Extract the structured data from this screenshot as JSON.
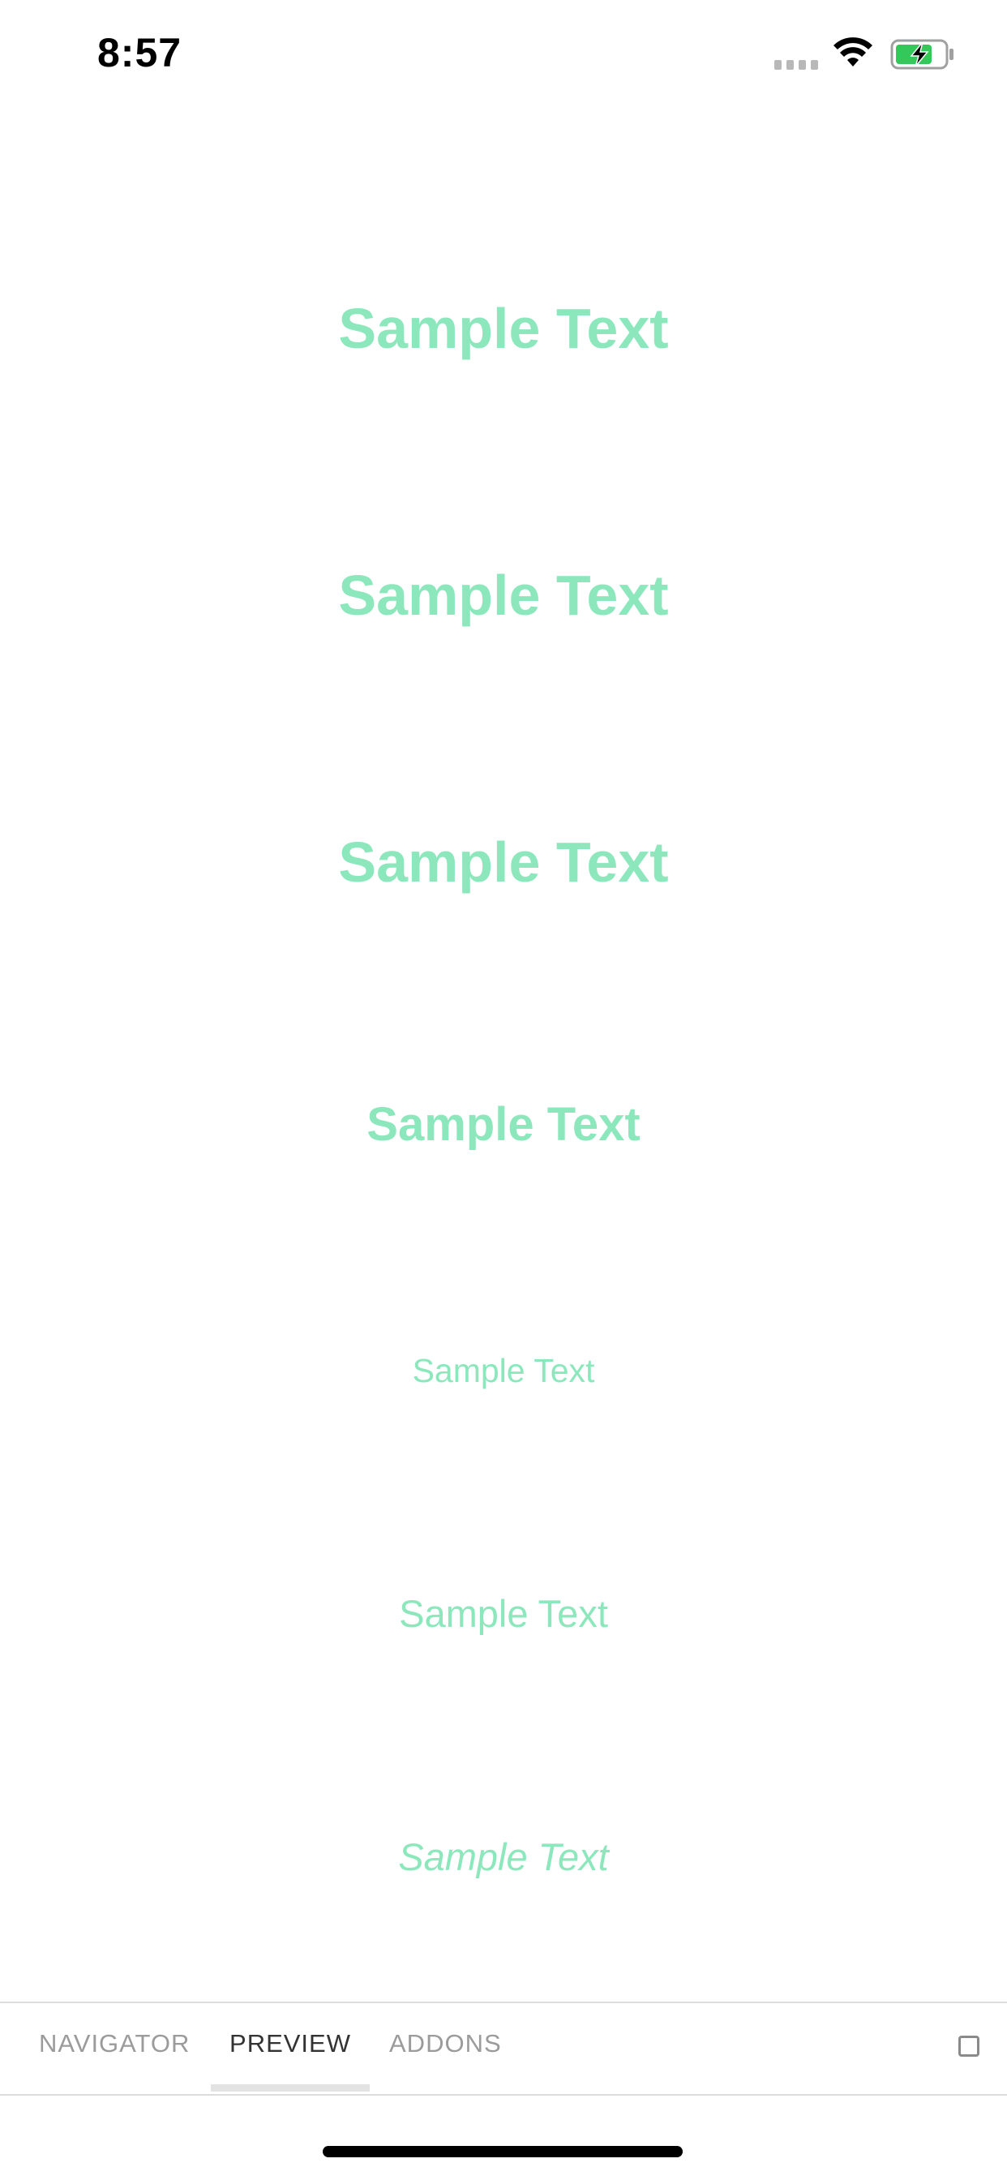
{
  "status_bar": {
    "time": "8:57",
    "signal_icon": "cellular-dots-icon",
    "wifi_icon": "wifi-icon",
    "battery_icon": "battery-charging-icon",
    "battery_color": "#34c759"
  },
  "content": {
    "text_color": "#8ce8bc",
    "samples": [
      {
        "text": "Sample Text",
        "style": "bold"
      },
      {
        "text": "Sample Text",
        "style": "bold"
      },
      {
        "text": "Sample Text",
        "style": "bold"
      },
      {
        "text": "Sample Text",
        "style": "bold"
      },
      {
        "text": "Sample Text",
        "style": "regular"
      },
      {
        "text": "Sample Text",
        "style": "regular"
      },
      {
        "text": "Sample Text",
        "style": "italic"
      }
    ]
  },
  "tab_bar": {
    "tabs": [
      {
        "label": "NAVIGATOR",
        "active": false
      },
      {
        "label": "PREVIEW",
        "active": true
      },
      {
        "label": "ADDONS",
        "active": false
      }
    ],
    "fullscreen_icon": "fullscreen-toggle-icon"
  }
}
